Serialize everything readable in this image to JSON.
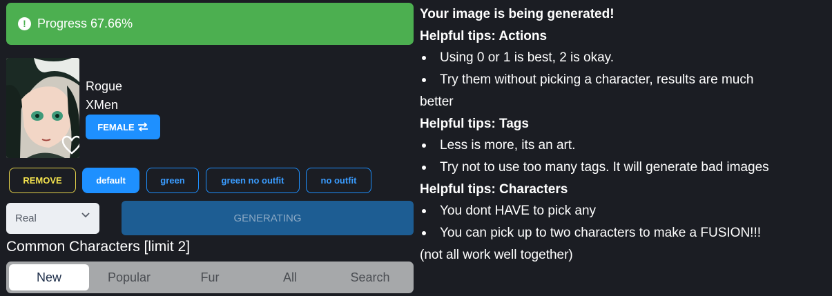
{
  "progress": {
    "text": "Progress 67.66%",
    "value_percent": 67.66,
    "color": "#4caf50"
  },
  "character": {
    "name": "Rogue",
    "series": "XMen",
    "gender_button": "FEMALE",
    "gender_icon": "swap-arrows-icon",
    "favorite_icon": "heart-outline-icon"
  },
  "chips": {
    "remove": "REMOVE",
    "default": "default",
    "green": "green",
    "green_no_outfit": "green no outfit",
    "no_outfit": "no outfit"
  },
  "style_select": {
    "selected": "Real"
  },
  "generate_button": "GENERATING",
  "common_characters": {
    "title": "Common Characters [limit 2]",
    "tabs": [
      "New",
      "Popular",
      "Fur",
      "All",
      "Search"
    ],
    "active_tab": "New"
  },
  "tips": {
    "heading": "Your image is being generated!",
    "actions_title": "Helpful tips: Actions",
    "actions": [
      "Using 0 or 1 is best, 2 is okay.",
      "Try them without picking a character, results are much",
      "better"
    ],
    "tags_title": "Helpful tips: Tags",
    "tags": [
      "Less is more, its an art.",
      "Try not to use too many tags. It will generate bad images"
    ],
    "characters_title": "Helpful tips: Characters",
    "characters": [
      "You dont HAVE to pick any",
      "You can pick up to two characters to make a FUSION!!!",
      "(not all work well together)"
    ]
  },
  "colors": {
    "background": "#1b1d23",
    "accent_blue": "#1e90ff",
    "remove_yellow": "#f2e14d",
    "progress_green": "#4caf50"
  }
}
